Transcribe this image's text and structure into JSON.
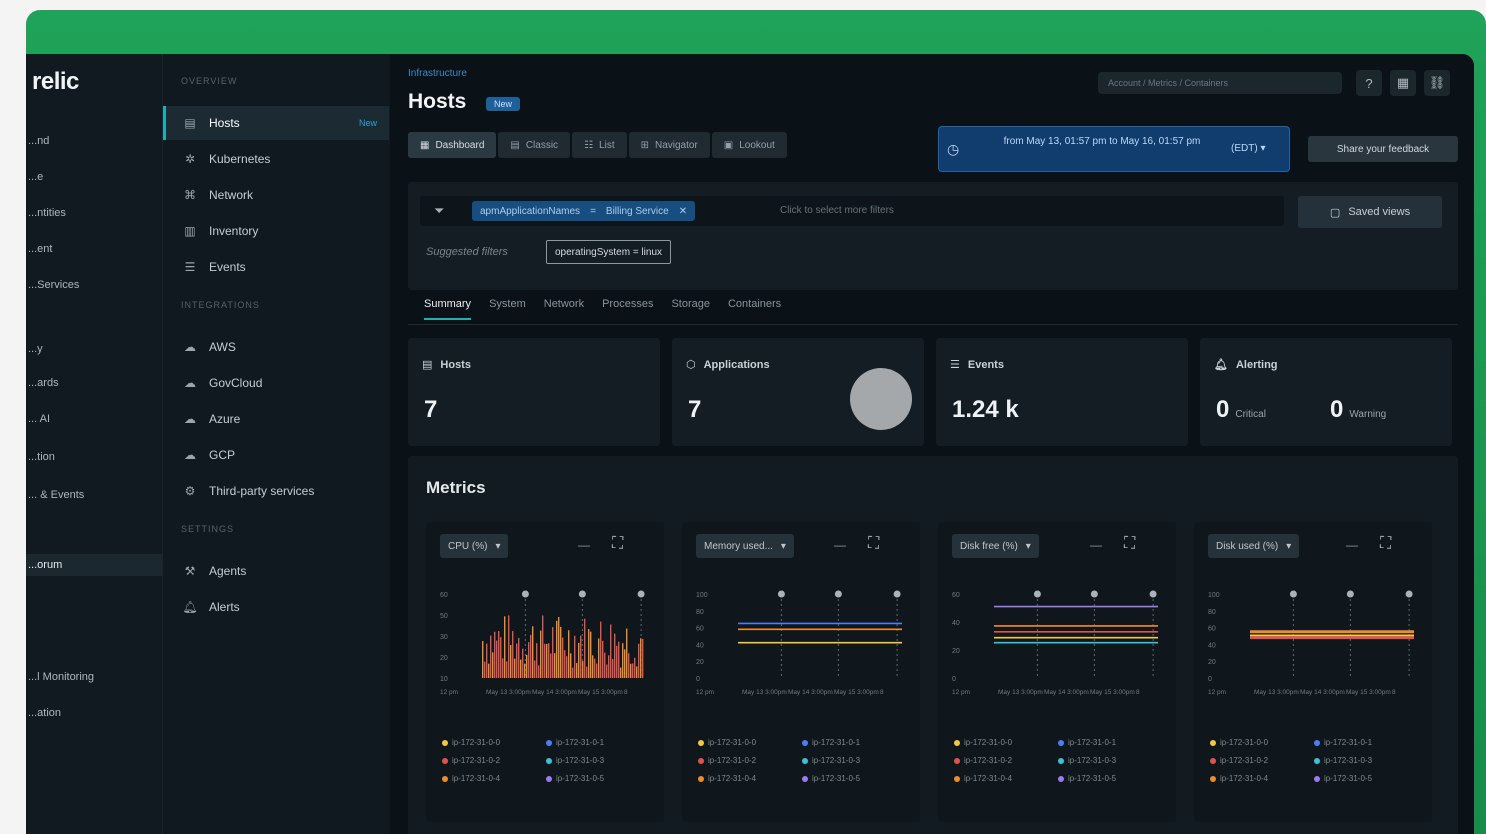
{
  "app": {
    "logo": "relic",
    "nav_items": [
      "...nd",
      "...e",
      "...ntities",
      "...ent",
      "...Services",
      "...y",
      "...ards",
      "... AI",
      "...tion",
      "... & Events",
      "...orum",
      "...l Monitoring",
      "...ation"
    ]
  },
  "subnav": {
    "sections": [
      "OVERVIEW",
      "INTEGRATIONS",
      "SETTINGS"
    ],
    "overview_items": [
      {
        "label": "Hosts",
        "icon": "hosts-icon",
        "badge": "New"
      },
      {
        "label": "Kubernetes",
        "icon": "kubernetes-icon"
      },
      {
        "label": "Network",
        "icon": "network-icon"
      },
      {
        "label": "Inventory",
        "icon": "inventory-icon"
      },
      {
        "label": "Events",
        "icon": "events-icon"
      }
    ],
    "integration_items": [
      {
        "label": "AWS",
        "icon": "cloud-icon"
      },
      {
        "label": "GovCloud",
        "icon": "cloud-icon"
      },
      {
        "label": "Azure",
        "icon": "cloud-icon"
      },
      {
        "label": "GCP",
        "icon": "cloud-icon"
      },
      {
        "label": "Third-party services",
        "icon": "gear-icon"
      }
    ],
    "settings_items": [
      {
        "label": "Agents",
        "icon": "agents-icon"
      },
      {
        "label": "Alerts",
        "icon": "bell-icon"
      }
    ]
  },
  "header": {
    "breadcrumb": "Infrastructure",
    "title": "Hosts",
    "title_badge": "New",
    "search_placeholder": "Account / Metrics / Containers"
  },
  "view_tabs": [
    "Dashboard",
    "Classic",
    "List",
    "Navigator",
    "Lookout"
  ],
  "timepicker": {
    "text": "from May 13, 01:57 pm to May 16, 01:57 pm",
    "zone": "(EDT)"
  },
  "share_button": "Share your feedback",
  "filter": {
    "chip_key": "apmApplicationNames",
    "chip_value": "Billing Service",
    "placeholder": "Click to select more filters",
    "saved_views": "Saved views",
    "suggested_label": "Suggested filters",
    "suggested_chip": "operatingSystem = linux"
  },
  "subtabs": [
    "Summary",
    "System",
    "Network",
    "Processes",
    "Storage",
    "Containers"
  ],
  "kpis": [
    {
      "label": "Hosts",
      "value": "7",
      "icon": "hosts-icon"
    },
    {
      "label": "Applications",
      "value": "7",
      "icon": "applications-icon"
    },
    {
      "label": "Events",
      "value": "1.24 k",
      "icon": "events-icon"
    },
    {
      "label": "Alerting",
      "critical_value": "0",
      "critical_label": "Critical",
      "warning_value": "0",
      "warning_label": "Warning",
      "icon": "bell-icon"
    }
  ],
  "metrics": {
    "title": "Metrics",
    "cards": [
      {
        "selector": "CPU (%)",
        "yticks": [
          "60",
          "50",
          "30",
          "20",
          "10"
        ],
        "xticks": [
          "12 pm",
          "May 13 3:00pm",
          "May 14 3:00pm",
          "May 15 3:00pm",
          "8"
        ],
        "legend": [
          "ip-172-31-0-0",
          "ip-172-31-0-1",
          "ip-172-31-0-2",
          "ip-172-31-0-3",
          "ip-172-31-0-4",
          "ip-172-31-0-5"
        ]
      },
      {
        "selector": "Memory used...",
        "yticks": [
          "100",
          "80",
          "60",
          "40",
          "20",
          "0"
        ],
        "xticks": [
          "12 pm",
          "May 13 3:00pm",
          "May 14 3:00pm",
          "May 15 3:00pm",
          "8"
        ],
        "legend": [
          "ip-172-31-0-0",
          "ip-172-31-0-1",
          "ip-172-31-0-2",
          "ip-172-31-0-3",
          "ip-172-31-0-4",
          "ip-172-31-0-5"
        ]
      },
      {
        "selector": "Disk free (%)",
        "yticks": [
          "60",
          "40",
          "20",
          "0"
        ],
        "xticks": [
          "12 pm",
          "May 13 3:00pm",
          "May 14 3:00pm",
          "May 15 3:00pm",
          "8"
        ],
        "legend": [
          "ip-172-31-0-0",
          "ip-172-31-0-1",
          "ip-172-31-0-2",
          "ip-172-31-0-3",
          "ip-172-31-0-4",
          "ip-172-31-0-5"
        ]
      },
      {
        "selector": "Disk used (%)",
        "yticks": [
          "100",
          "80",
          "60",
          "40",
          "20",
          "0"
        ],
        "xticks": [
          "12 pm",
          "May 13 3:00pm",
          "May 14 3:00pm",
          "May 15 3:00pm",
          "8"
        ],
        "legend": [
          "ip-172-31-0-0",
          "ip-172-31-0-1",
          "ip-172-31-0-2",
          "ip-172-31-0-3",
          "ip-172-31-0-4",
          "ip-172-31-0-5"
        ]
      }
    ]
  },
  "colors": {
    "accent": "#1cb0b4",
    "brand_green": "#1fa259",
    "series": [
      "#f5c842",
      "#4f7cff",
      "#e0544c",
      "#37c3d9",
      "#f08c2e",
      "#9a7cf0"
    ]
  }
}
